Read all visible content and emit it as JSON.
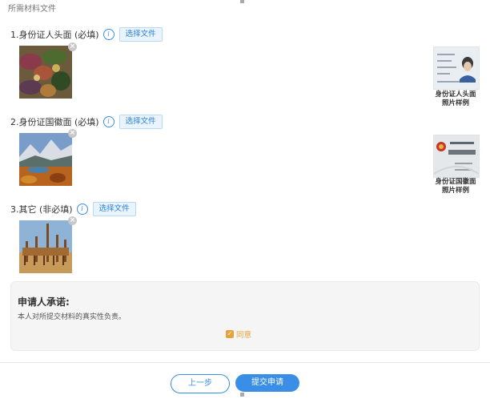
{
  "page": {
    "title": "所需材料文件"
  },
  "sections": [
    {
      "title": "1.身份证人头面 (必填)",
      "choose_label": "选择文件",
      "remove_symbol": "×"
    },
    {
      "title": "2.身份证国徽面 (必填)",
      "choose_label": "选择文件",
      "remove_symbol": "×"
    },
    {
      "title": "3.其它 (非必填)",
      "choose_label": "选择文件",
      "remove_symbol": "×"
    }
  ],
  "info_icon_symbol": "i",
  "samples": [
    {
      "caption_line1": "身份证人头面",
      "caption_line2": "照片样例"
    },
    {
      "caption_line1": "身份证国徽面",
      "caption_line2": "照片样例"
    }
  ],
  "commitment": {
    "title": "申请人承诺:",
    "text": "本人对所提交材料的真实性负责。",
    "agree_label": "同意",
    "checked_symbol": "✓"
  },
  "footer": {
    "prev_label": "上一步",
    "submit_label": "提交申请"
  },
  "colors": {
    "accent": "#3a8ee6",
    "warning": "#e6a23c",
    "panel": "#f5f5f5"
  }
}
